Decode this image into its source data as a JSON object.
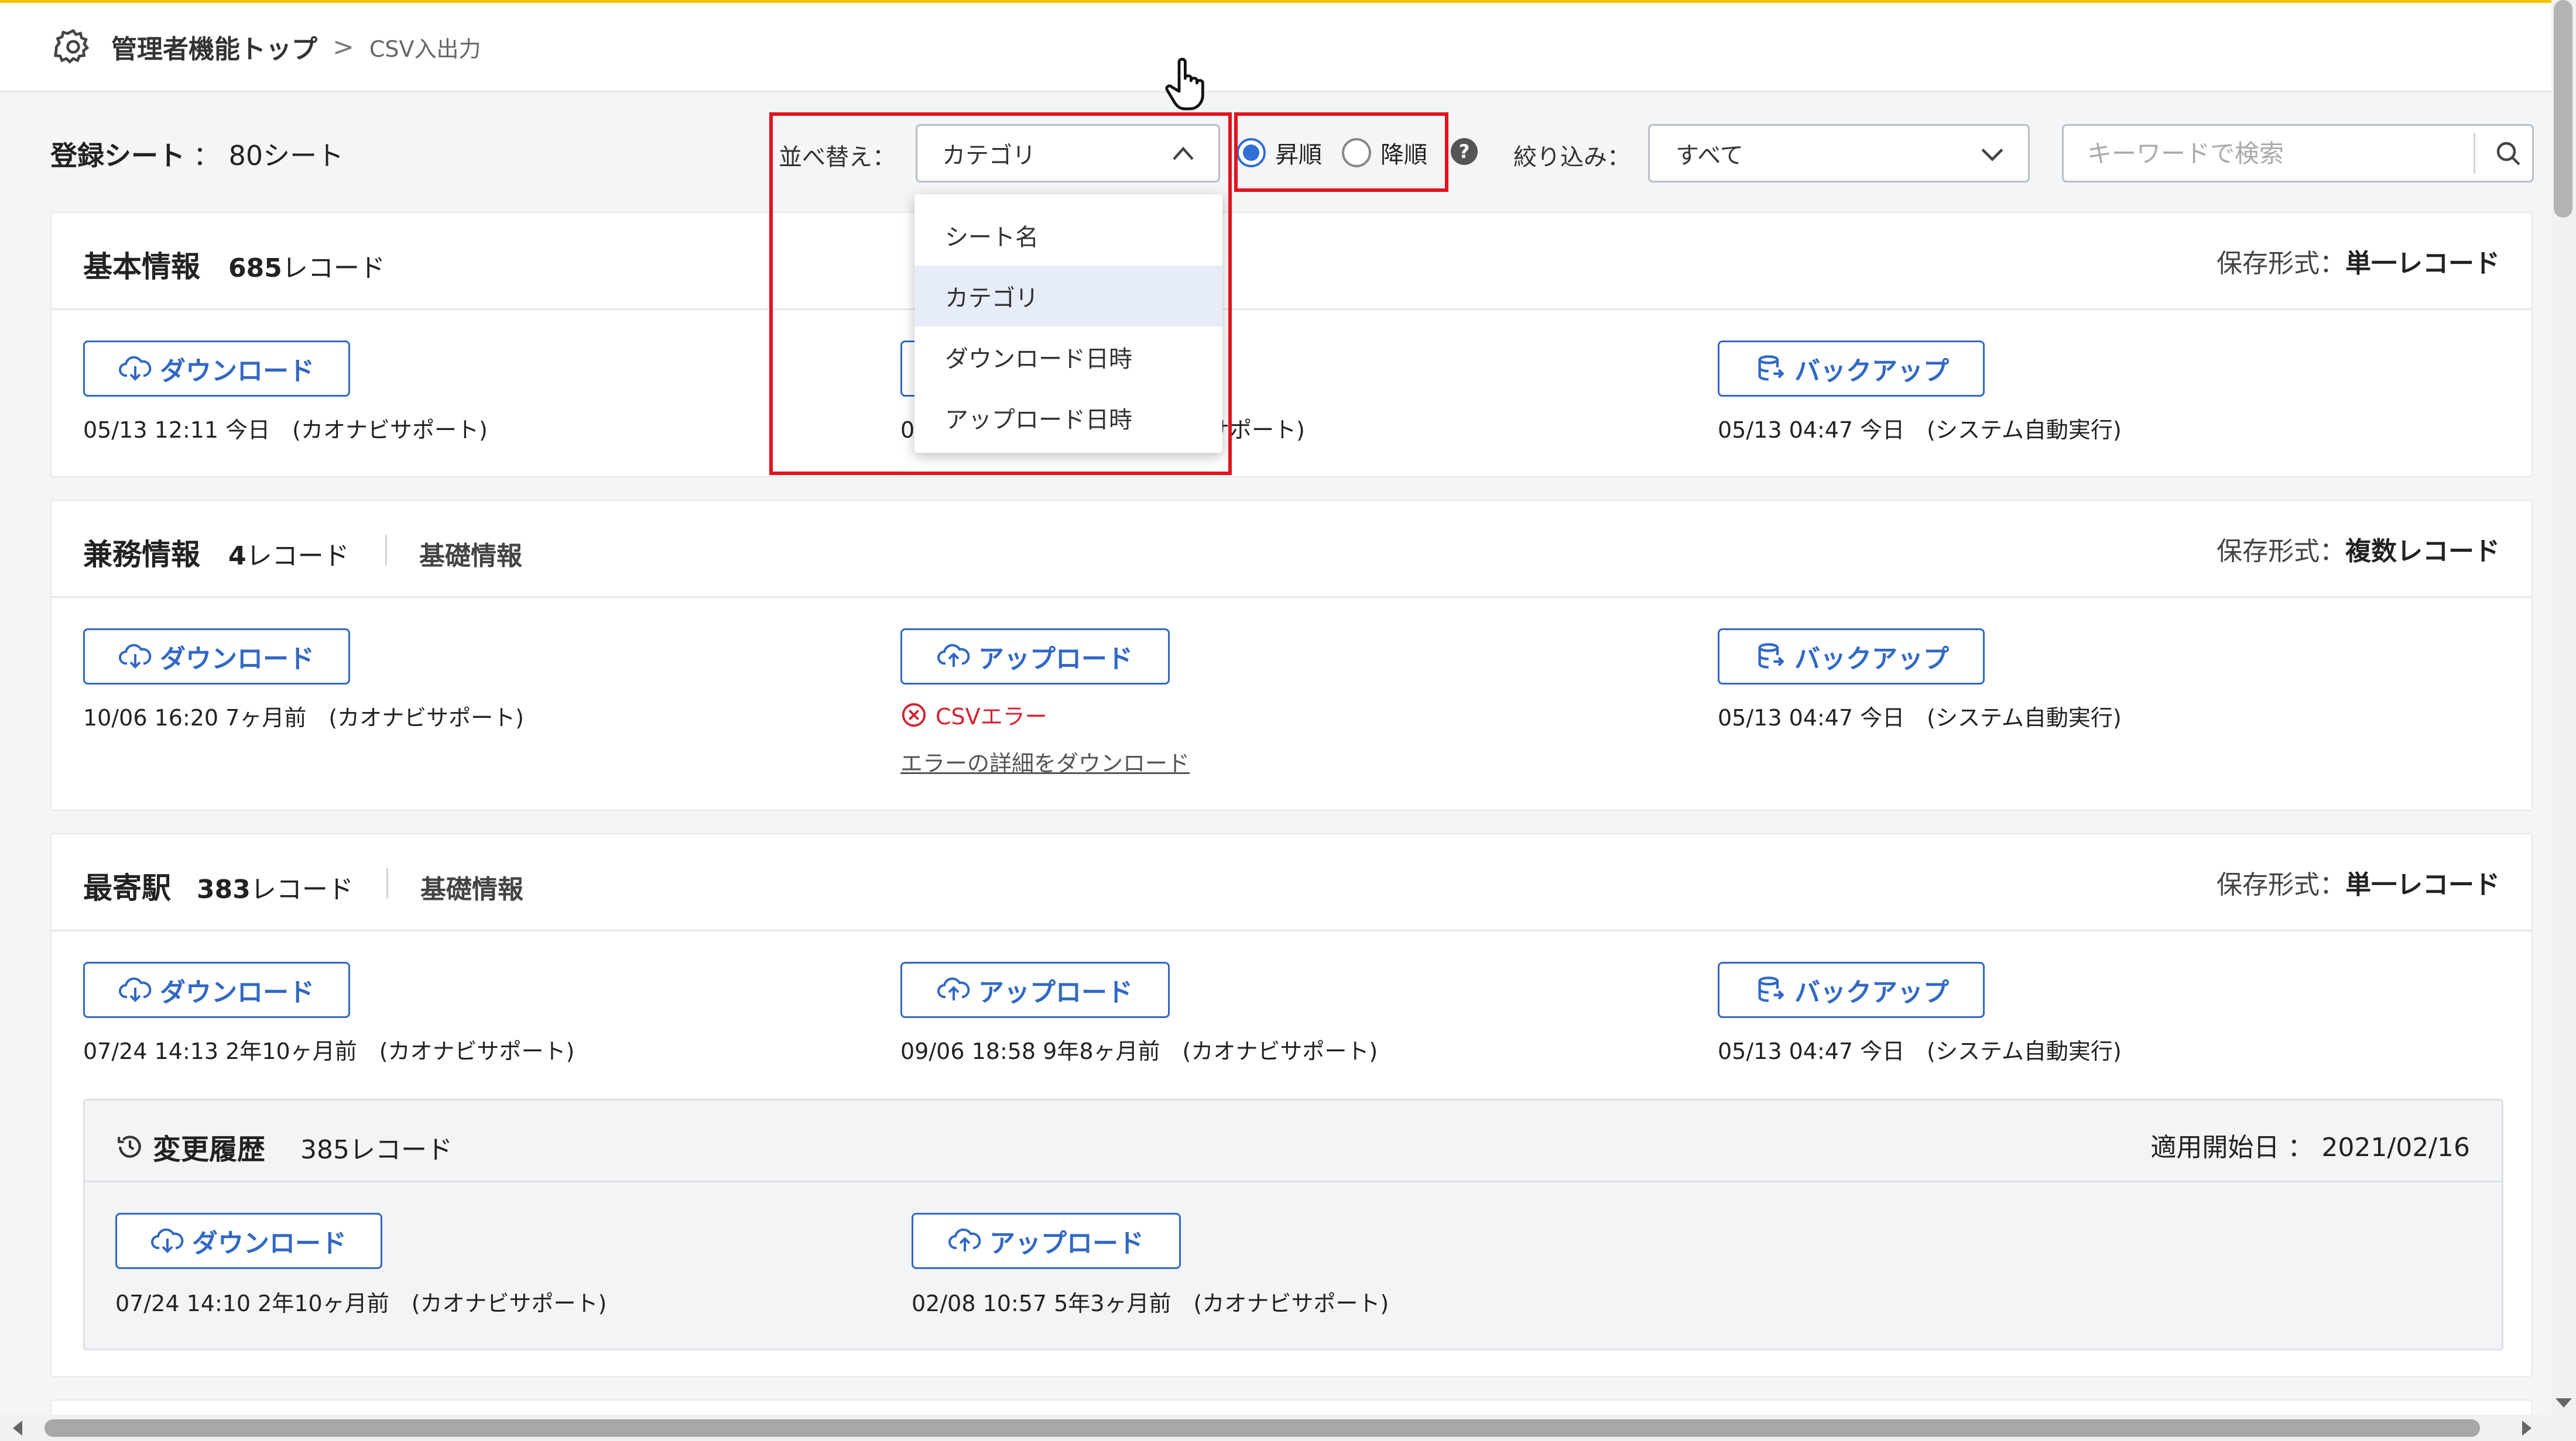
{
  "breadcrumb": {
    "home": "管理者機能トップ",
    "separator": ">",
    "current": "CSV入出力"
  },
  "toolbar": {
    "registered_label": "登録シート",
    "registered_value": "： 80シート",
    "sort_label": "並べ替え：",
    "sort_selected": "カテゴリ",
    "order_asc": "昇順",
    "order_desc": "降順",
    "order_selected": "昇順",
    "help": "?",
    "filter_label": "絞り込み：",
    "filter_selected": "すべて",
    "search_placeholder": "キーワードで検索"
  },
  "sort_options": [
    "シート名",
    "カテゴリ",
    "ダウンロード日時",
    "アップロード日時"
  ],
  "buttons": {
    "download": "ダウンロード",
    "upload": "アップロード",
    "backup": "バックアップ"
  },
  "cards": [
    {
      "title": "基本情報",
      "count": "685",
      "count_unit": "レコード",
      "category": "",
      "format_label": "保存形式：",
      "format_value": "単一レコード",
      "download_meta": "05/13 12:11 今日　(カオナビサポート)",
      "upload_meta": "05/13 12:11 今日　(カオナビサポート)",
      "backup_meta": "05/13 04:47 今日　(システム自動実行)"
    },
    {
      "title": "兼務情報",
      "count": "4",
      "count_unit": "レコード",
      "category": "基礎情報",
      "format_label": "保存形式：",
      "format_value": "複数レコード",
      "download_meta": "10/06 16:20 7ヶ月前　(カオナビサポート)",
      "upload_error": "CSVエラー",
      "upload_error_link": "エラーの詳細をダウンロード",
      "backup_meta": "05/13 04:47 今日　(システム自動実行)"
    },
    {
      "title": "最寄駅",
      "count": "383",
      "count_unit": "レコード",
      "category": "基礎情報",
      "format_label": "保存形式：",
      "format_value": "単一レコード",
      "download_meta": "07/24 14:13 2年10ヶ月前　(カオナビサポート)",
      "upload_meta": "09/06 18:58 9年8ヶ月前　(カオナビサポート)",
      "backup_meta": "05/13 04:47 今日　(システム自動実行)",
      "history": {
        "title": "変更履歴",
        "count": "385レコード",
        "date_label": "適用開始日 ： 2021/02/16",
        "download_meta": "07/24 14:10 2年10ヶ月前　(カオナビサポート)",
        "upload_meta": "02/08 10:57 5年3ヶ月前　(カオナビサポート)"
      }
    }
  ],
  "colors": {
    "accent": "#3168c4",
    "highlight_box": "#e0141e",
    "error": "#d3232f",
    "top_border": "#f2c200"
  }
}
